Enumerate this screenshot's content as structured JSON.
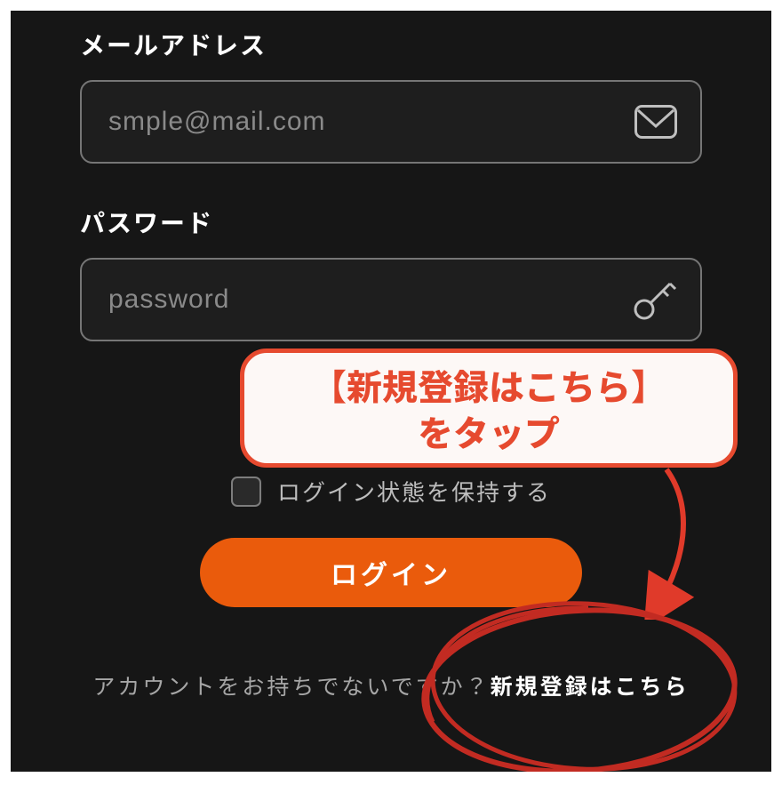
{
  "email": {
    "label": "メールアドレス",
    "placeholder": "smple@mail.com"
  },
  "password": {
    "label": "パスワード",
    "placeholder": "password"
  },
  "remember": {
    "label": "ログイン状態を保持する"
  },
  "login_button": "ログイン",
  "signup": {
    "question": "アカウントをお持ちでないですか？",
    "link": "新規登録はこちら"
  },
  "annotation": {
    "callout": "【新規登録はこちら】\nをタップ"
  },
  "colors": {
    "accent": "#ea5b0c",
    "callout": "#e64a2f"
  }
}
